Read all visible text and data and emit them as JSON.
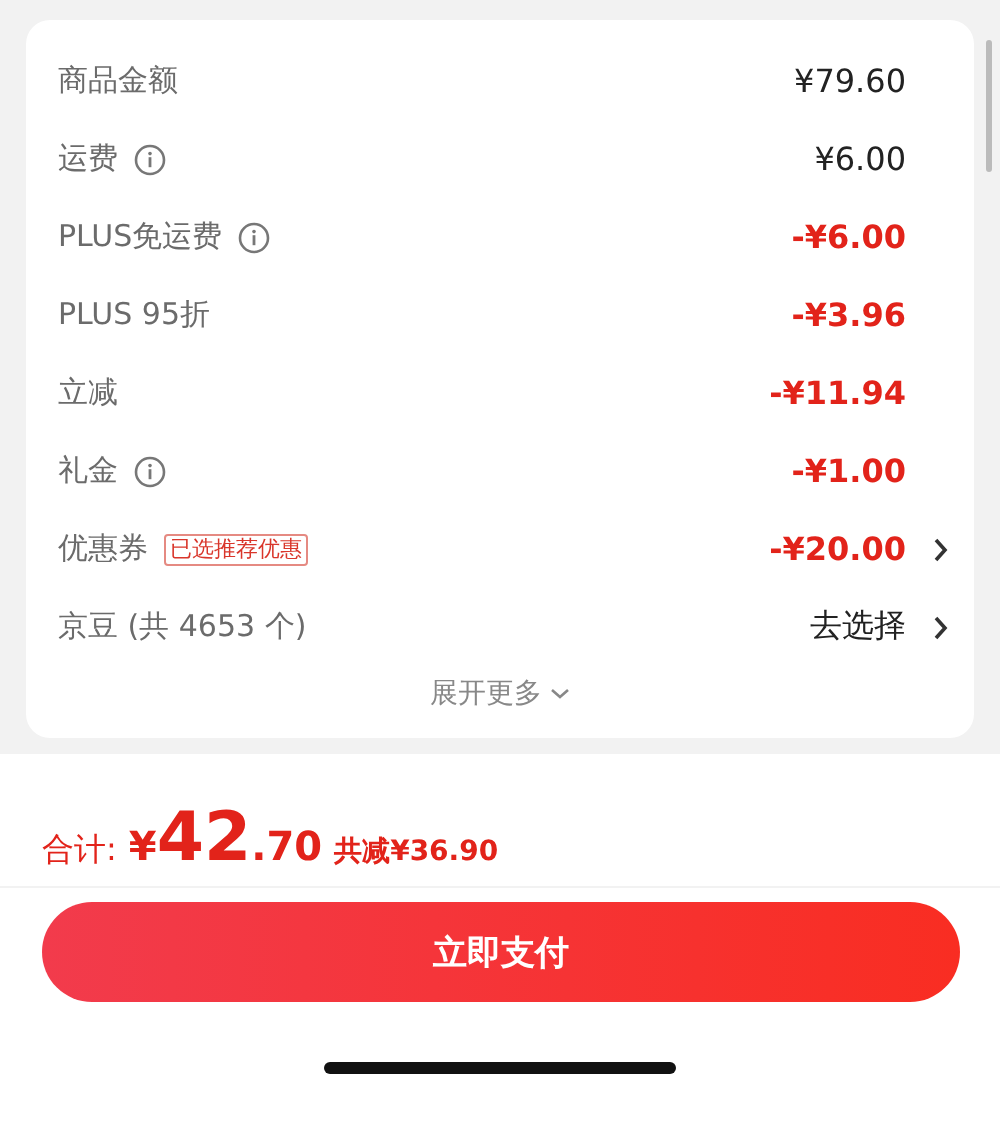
{
  "summary_rows": [
    {
      "label": "商品金额",
      "info": false,
      "kind": "charge",
      "value": "¥79.60",
      "chevron": false
    },
    {
      "label": "运费",
      "info": true,
      "kind": "charge",
      "value": "¥6.00",
      "chevron": false
    },
    {
      "label": "PLUS免运费",
      "info": true,
      "kind": "discount",
      "value": "-¥6.00",
      "chevron": false
    },
    {
      "label": "PLUS 95折",
      "info": false,
      "kind": "discount",
      "value": "-¥3.96",
      "chevron": false
    },
    {
      "label": "立减",
      "info": false,
      "kind": "discount",
      "value": "-¥11.94",
      "chevron": false
    },
    {
      "label": "礼金",
      "info": true,
      "kind": "discount",
      "value": "-¥1.00",
      "chevron": false
    },
    {
      "label": "优惠券",
      "info": false,
      "tag": "已选推荐优惠",
      "kind": "discount",
      "value": "-¥20.00",
      "chevron": true
    },
    {
      "label": "京豆 (共 4653 个)",
      "info": false,
      "kind": "charge",
      "value": "去选择",
      "chevron": true
    }
  ],
  "expand_link": "展开更多",
  "total": {
    "label": "合计:",
    "currency": "¥",
    "integer": "42",
    "decimal": ".70",
    "saved": "共减¥36.90"
  },
  "pay_button": "立即支付"
}
